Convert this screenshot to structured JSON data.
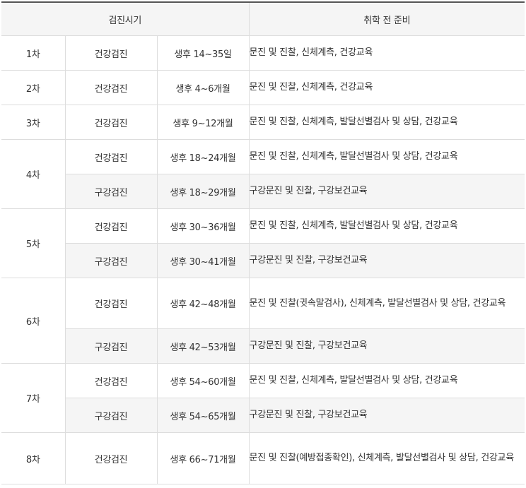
{
  "header": {
    "timing": "검진시기",
    "prep": "취학 전 준비"
  },
  "rounds": [
    {
      "label": "1차",
      "rows": [
        {
          "type": "건강검진",
          "age": "생후 14~35일",
          "prep": "문진 및 진찰, 신체계측, 건강교육"
        }
      ]
    },
    {
      "label": "2차",
      "rows": [
        {
          "type": "건강검진",
          "age": "생후 4~6개월",
          "prep": "문진 및 진찰, 신체계측, 건강교육"
        }
      ]
    },
    {
      "label": "3차",
      "rows": [
        {
          "type": "건강검진",
          "age": "생후 9~12개월",
          "prep": "문진 및 진찰, 신체계측, 발달선별검사 및 상담, 건강교육"
        }
      ]
    },
    {
      "label": "4차",
      "rows": [
        {
          "type": "건강검진",
          "age": "생후 18~24개월",
          "prep": "문진 및 진찰, 신체계측, 발달선별검사 및 상담, 건강교육"
        },
        {
          "type": "구강검진",
          "age": "생후 18~29개월",
          "prep": "구강문진 및 진찰, 구강보건교육"
        }
      ]
    },
    {
      "label": "5차",
      "rows": [
        {
          "type": "건강검진",
          "age": "생후 30~36개월",
          "prep": "문진 및 진찰, 신체계측, 발달선별검사 및 상담, 건강교육"
        },
        {
          "type": "구강검진",
          "age": "생후 30~41개월",
          "prep": "구강문진 및 진찰, 구강보건교육"
        }
      ]
    },
    {
      "label": "6차",
      "rows": [
        {
          "type": "건강검진",
          "age": "생후 42~48개월",
          "prep": "문진 및 진찰(귓속말검사), 신체계측, 발달선별검사 및 상담, 건강교육"
        },
        {
          "type": "구강검진",
          "age": "생후 42~53개월",
          "prep": "구강문진 및 진찰, 구강보건교육"
        }
      ]
    },
    {
      "label": "7차",
      "rows": [
        {
          "type": "건강검진",
          "age": "생후 54~60개월",
          "prep": "문진 및 진찰, 신체계측, 발달선별검사 및 상담, 건강교육"
        },
        {
          "type": "구강검진",
          "age": "생후 54~65개월",
          "prep": "구강문진 및 진찰, 구강보건교육"
        }
      ]
    },
    {
      "label": "8차",
      "rows": [
        {
          "type": "건강검진",
          "age": "생후 66~71개월",
          "prep": "문진 및 진찰(예방접종확인), 신체계측, 발달선별검사 및 상담, 건강교육"
        }
      ]
    }
  ]
}
